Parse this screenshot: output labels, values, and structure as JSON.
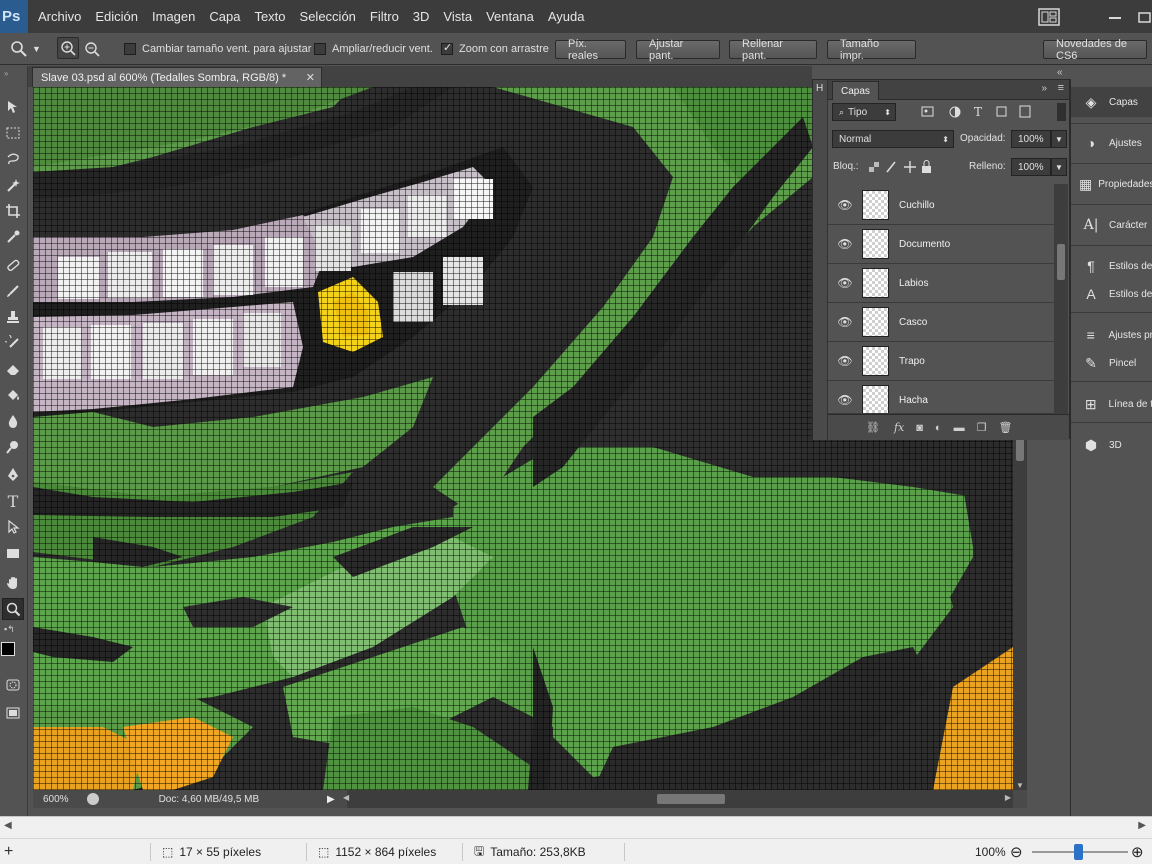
{
  "app": {
    "logo": "Ps"
  },
  "menu": [
    "Archivo",
    "Edición",
    "Imagen",
    "Capa",
    "Texto",
    "Selección",
    "Filtro",
    "3D",
    "Vista",
    "Ventana",
    "Ayuda"
  ],
  "options": {
    "resize_windows": "Cambiar tamaño vent. para ajustar",
    "zoom_all": "Ampliar/reducir vent.",
    "scrubby_zoom": "Zoom con arrastre",
    "actual_pixels": "Píx. reales",
    "fit_screen": "Ajustar pant.",
    "fill_screen": "Rellenar pant.",
    "print_size": "Tamaño impr.",
    "workspace": "Novedades de CS6"
  },
  "document": {
    "tab_title": "Slave 03.psd al 600% (Tedalles Sombra, RGB/8) *",
    "zoom": "600%",
    "doc_info": "Doc: 4,60 MB/49,5 MB"
  },
  "layers_panel": {
    "tab": "Capas",
    "filter": "Tipo",
    "blend_mode": "Normal",
    "opacity_label": "Opacidad:",
    "opacity": "100%",
    "lock_label": "Bloq.:",
    "fill_label": "Relleno:",
    "fill": "100%",
    "layers": [
      "Cuchillo",
      "Documento",
      "Labios",
      "Casco",
      "Trapo",
      "Hacha"
    ]
  },
  "dock": {
    "items": [
      "Capas",
      "Ajustes",
      "Propiedades",
      "Carácter",
      "Estilos de",
      "Estilos de",
      "Ajustes pr",
      "Pincel",
      "Línea de t",
      "3D"
    ]
  },
  "status": {
    "selection": "17 × 55 píxeles",
    "dimensions": "1152 × 864 píxeles",
    "size": "Tamaño: 253,8KB",
    "zoom": "100%"
  }
}
